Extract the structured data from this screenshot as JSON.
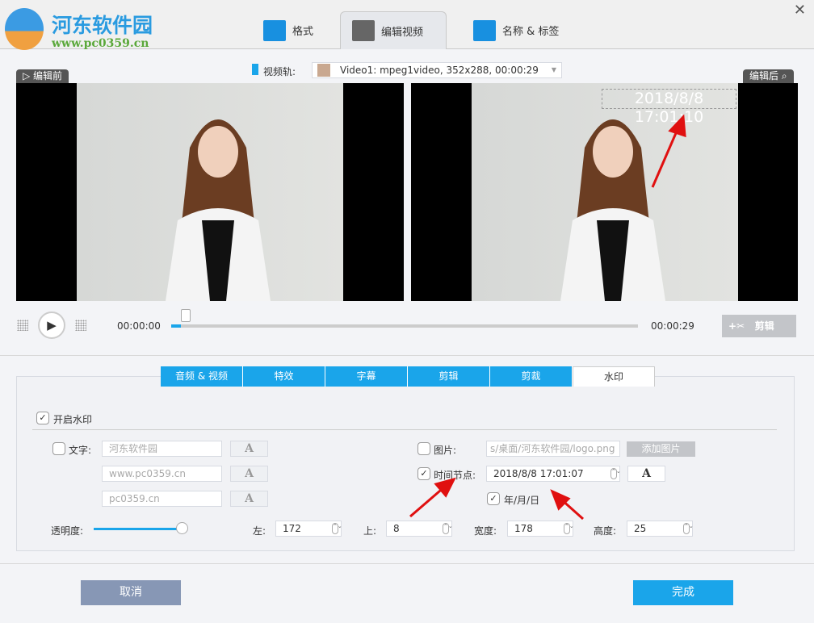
{
  "logo": {
    "title": "河东软件园",
    "url": "www.pc0359.cn"
  },
  "tabs": [
    {
      "label": "格式",
      "icon": "format-gear-icon"
    },
    {
      "label": "编辑视频",
      "icon": "film-scissors-icon"
    },
    {
      "label": "名称 & 标签",
      "icon": "edit-doc-icon"
    }
  ],
  "video_track": {
    "label": "视频轨:",
    "value": "Video1: mpeg1video, 352x288, 00:00:29"
  },
  "preview": {
    "before_label": "编辑前",
    "after_label": "编辑后",
    "overlay_text": "2018/8/8 17:01:10"
  },
  "player": {
    "current_time": "00:00:00",
    "total_time": "00:00:29",
    "progress": 0.02,
    "cut_label": "剪辑"
  },
  "panel_tabs": [
    "音频 & 视频",
    "特效",
    "字幕",
    "剪辑",
    "剪裁",
    "水印"
  ],
  "active_panel_tab": "水印",
  "watermark": {
    "enable_label": "开启水印",
    "enabled": true,
    "text_label": "文字:",
    "text_checked": false,
    "text_values": [
      "河东软件园",
      "www.pc0359.cn",
      "pc0359.cn"
    ],
    "font_button": "A",
    "image_label": "图片:",
    "image_checked": false,
    "image_path": "s/桌面/河东软件园/logo.png",
    "add_image_label": "添加图片",
    "time_label": "时间节点:",
    "time_checked": true,
    "time_value": "2018/8/8 17:01:07",
    "date_format_label": "年/月/日",
    "date_format_checked": true,
    "opacity_label": "透明度:",
    "opacity": 1.0,
    "left_label": "左:",
    "left": "172",
    "top_label": "上:",
    "top": "8",
    "width_label": "宽度:",
    "width": "178",
    "height_label": "高度:",
    "height": "25"
  },
  "footer": {
    "cancel": "取消",
    "done": "完成"
  },
  "colors": {
    "accent": "#1aa5ea",
    "cancel": "#8797b5",
    "arrow": "#e01010"
  }
}
